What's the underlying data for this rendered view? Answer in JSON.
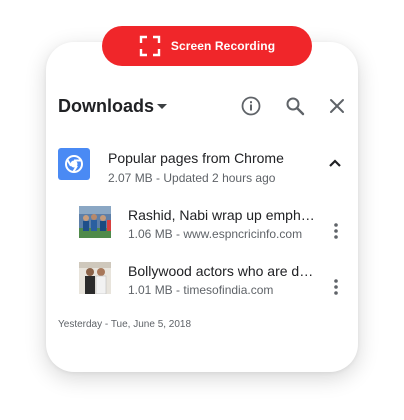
{
  "recording": {
    "label": "Screen Recording",
    "icon": "screen-record-icon",
    "color": "#f0262a"
  },
  "header": {
    "title": "Downloads",
    "dropdown_icon": "caret-down-icon",
    "actions": [
      {
        "name": "info",
        "icon": "info-icon"
      },
      {
        "name": "search",
        "icon": "search-icon"
      },
      {
        "name": "close",
        "icon": "close-icon"
      }
    ]
  },
  "group": {
    "title": "Popular pages from Chrome",
    "meta": "2.07 MB - Updated 2 hours ago",
    "icon": "chrome-icon",
    "icon_bg": "#4a8af4",
    "expanded": true
  },
  "items": [
    {
      "title": "Rashid, Nabi wrap up emphatic win",
      "meta": "1.06 MB - www.espncricinfo.com",
      "thumbnail": "cricket-photo"
    },
    {
      "title": "Bollywood actors who are doctors",
      "meta": "1.01 MB - timesofindia.com",
      "thumbnail": "bollywood-photo"
    }
  ],
  "date_header": "Yesterday - Tue, June 5, 2018"
}
